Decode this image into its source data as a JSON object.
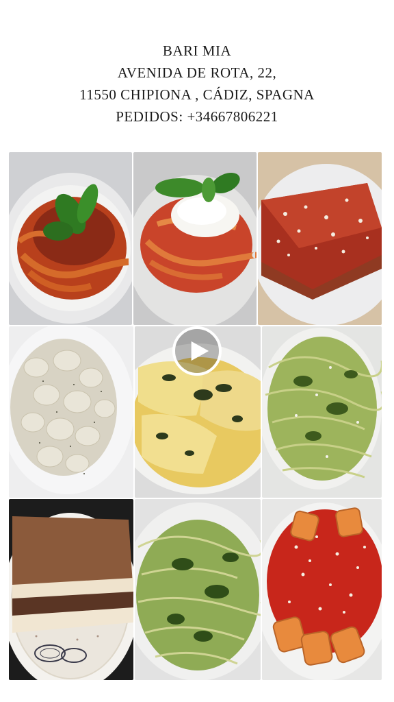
{
  "header": {
    "line1": "BARI MIA",
    "line2": "AVENIDA DE ROTA, 22,",
    "line3": "11550 CHIPIONA , CÁDIZ, SPAGNA",
    "line4": "PEDIDOS: +34667806221"
  },
  "video": {
    "play_icon": "play-icon"
  }
}
